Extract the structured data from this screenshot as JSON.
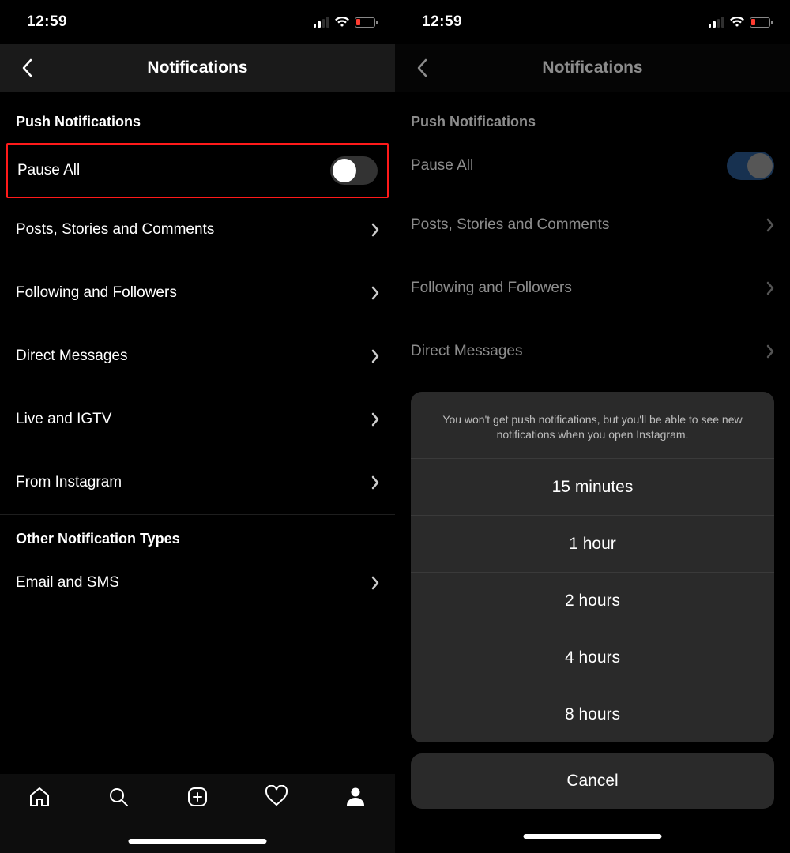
{
  "statusbar": {
    "time": "12:59"
  },
  "header": {
    "title": "Notifications"
  },
  "sections": {
    "push_title": "Push Notifications",
    "other_title": "Other Notification Types"
  },
  "rows": {
    "pause_all": "Pause All",
    "posts": "Posts, Stories and Comments",
    "following": "Following and Followers",
    "dm": "Direct Messages",
    "live": "Live and IGTV",
    "from_ig": "From Instagram",
    "email_sms": "Email and SMS"
  },
  "sheet": {
    "message": "You won't get push notifications, but you'll be able to see new notifications when you open Instagram.",
    "options": [
      "15 minutes",
      "1 hour",
      "2 hours",
      "4 hours",
      "8 hours"
    ],
    "cancel": "Cancel"
  }
}
